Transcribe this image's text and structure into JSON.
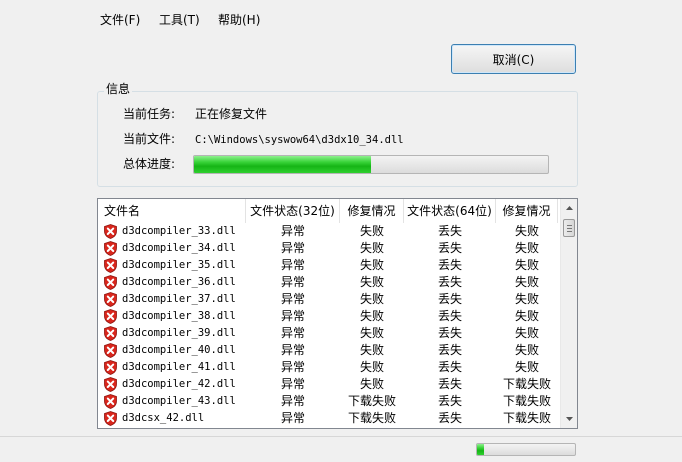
{
  "menu": {
    "file": "文件(F)",
    "tools": "工具(T)",
    "help": "帮助(H)"
  },
  "buttons": {
    "cancel": "取消(C)"
  },
  "info": {
    "group_title": "信息",
    "task_label": "当前任务:",
    "task_value": "正在修复文件",
    "file_label": "当前文件:",
    "file_value": "C:\\Windows\\syswow64\\d3dx10_34.dll",
    "progress_label": "总体进度:",
    "progress_fraction": 0.5
  },
  "table": {
    "columns": [
      "文件名",
      "文件状态(32位)",
      "修复情况",
      "文件状态(64位)",
      "修复情况"
    ],
    "rows": [
      [
        "d3dcompiler_33.dll",
        "异常",
        "失败",
        "丢失",
        "失败"
      ],
      [
        "d3dcompiler_34.dll",
        "异常",
        "失败",
        "丢失",
        "失败"
      ],
      [
        "d3dcompiler_35.dll",
        "异常",
        "失败",
        "丢失",
        "失败"
      ],
      [
        "d3dcompiler_36.dll",
        "异常",
        "失败",
        "丢失",
        "失败"
      ],
      [
        "d3dcompiler_37.dll",
        "异常",
        "失败",
        "丢失",
        "失败"
      ],
      [
        "d3dcompiler_38.dll",
        "异常",
        "失败",
        "丢失",
        "失败"
      ],
      [
        "d3dcompiler_39.dll",
        "异常",
        "失败",
        "丢失",
        "失败"
      ],
      [
        "d3dcompiler_40.dll",
        "异常",
        "失败",
        "丢失",
        "失败"
      ],
      [
        "d3dcompiler_41.dll",
        "异常",
        "失败",
        "丢失",
        "失败"
      ],
      [
        "d3dcompiler_42.dll",
        "异常",
        "失败",
        "丢失",
        "下载失败"
      ],
      [
        "d3dcompiler_43.dll",
        "异常",
        "下载失败",
        "丢失",
        "下载失败"
      ],
      [
        "d3dcsx_42.dll",
        "异常",
        "下载失败",
        "丢失",
        "下载失败"
      ]
    ],
    "row_icon": "shield-x-icon"
  },
  "status": {
    "progress_fraction": 0.07
  },
  "colors": {
    "progress_green": "#16b516",
    "icon_red": "#d9261c",
    "button_border": "#3c7fb1"
  }
}
